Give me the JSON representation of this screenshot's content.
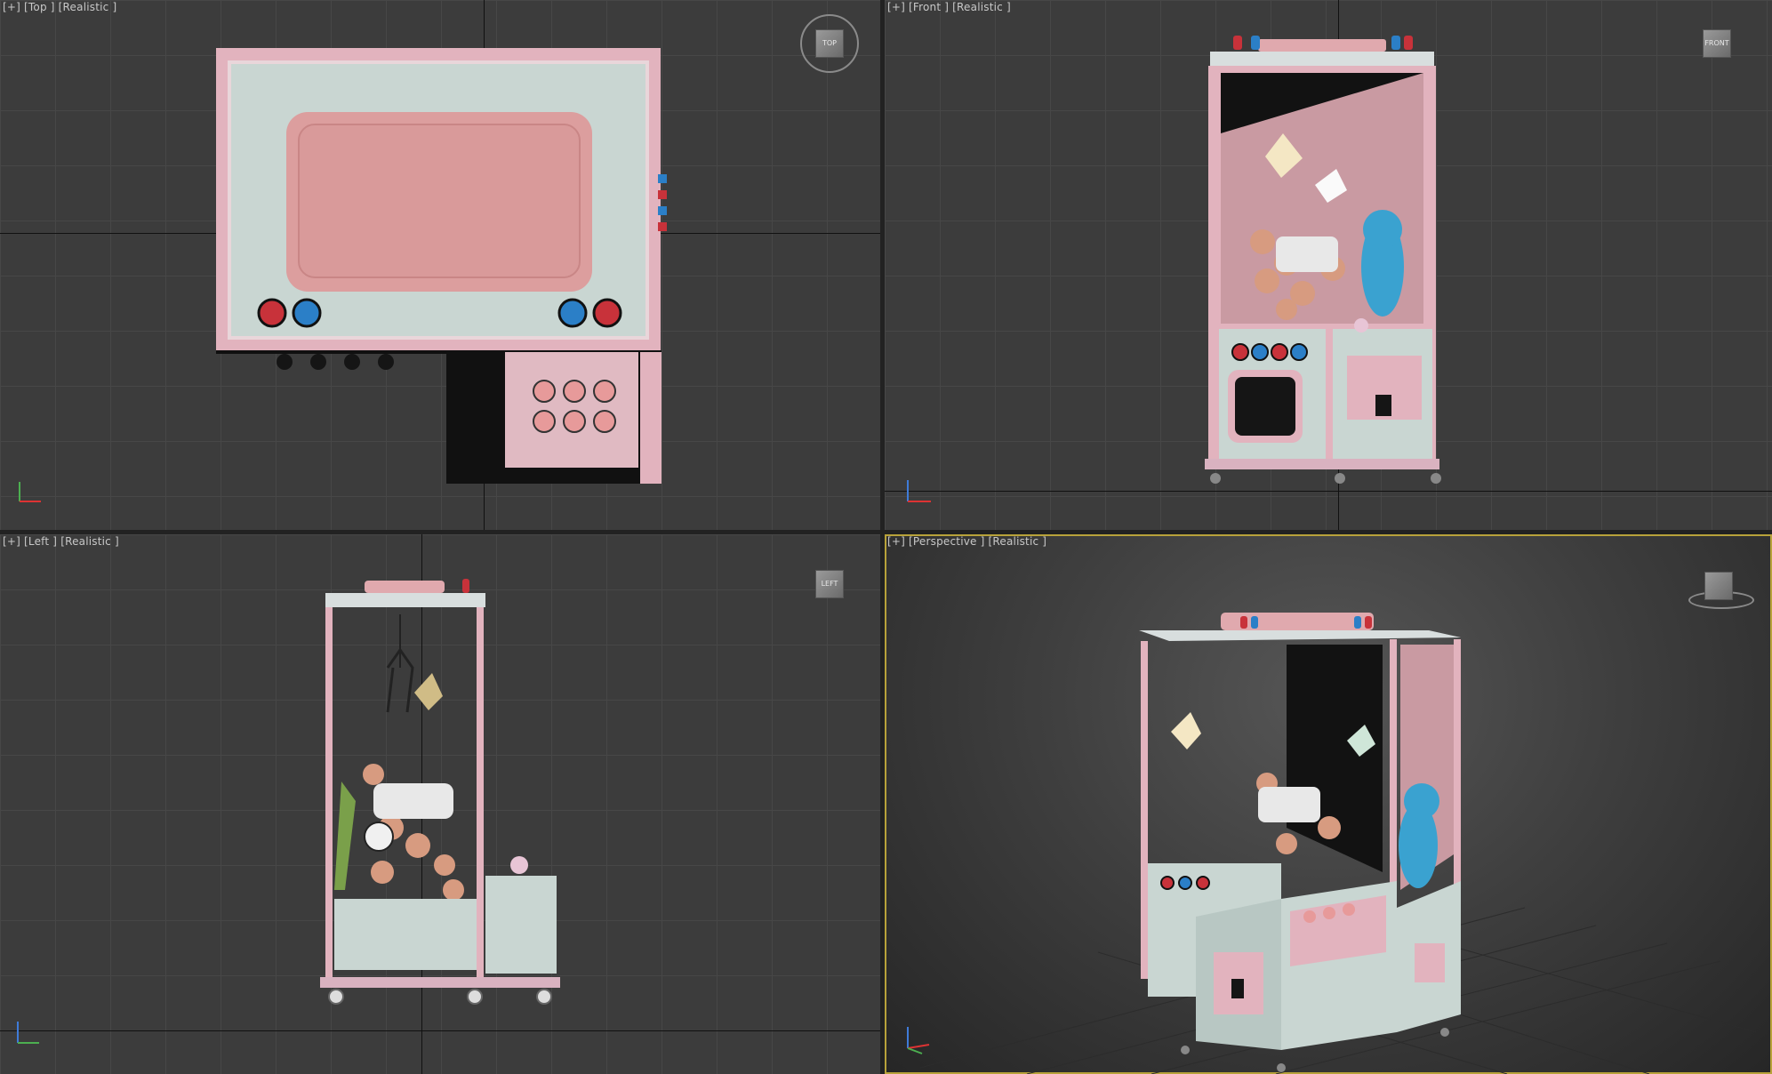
{
  "viewports": {
    "top": {
      "label": "[+] [Top ] [Realistic ]",
      "cube_label": "TOP"
    },
    "front": {
      "label": "[+] [Front ] [Realistic ]",
      "cube_label": "FRONT"
    },
    "left": {
      "label": "[+] [Left ] [Realistic ]",
      "cube_label": "LEFT"
    },
    "perspective": {
      "label": "[+] [Perspective ] [Realistic ]",
      "cube_label": ""
    }
  },
  "colors": {
    "viewport_bg": "#3c3c3c",
    "grid": "#474747",
    "cabinet_pink": "#e2b3be",
    "panel_mint": "#c9d6d2",
    "screen_pink": "#d99a9a",
    "button_red": "#c8323a",
    "button_blue": "#2b7fc7",
    "active_border": "#b8a23a"
  },
  "icons": [
    "viewcube-icon",
    "axis-gizmo-icon"
  ]
}
